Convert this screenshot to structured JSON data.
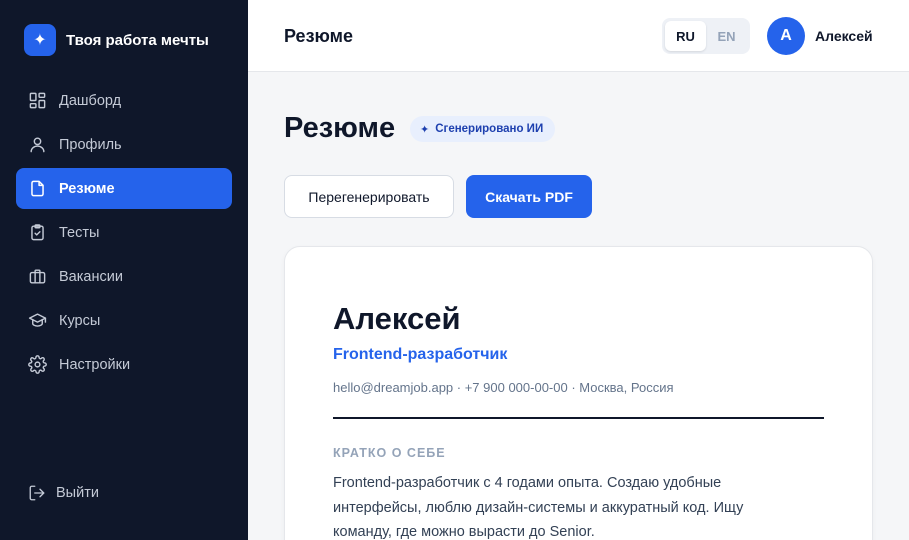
{
  "brand": {
    "title": "Твоя работа мечты",
    "logo_icon": "sparkle-icon"
  },
  "sidebar": {
    "items": [
      {
        "label": "Дашборд",
        "icon": "dashboard-icon",
        "active": false
      },
      {
        "label": "Профиль",
        "icon": "user-icon",
        "active": false
      },
      {
        "label": "Резюме",
        "icon": "document-icon",
        "active": true
      },
      {
        "label": "Тесты",
        "icon": "clipboard-check-icon",
        "active": false
      },
      {
        "label": "Вакансии",
        "icon": "briefcase-icon",
        "active": false
      },
      {
        "label": "Курсы",
        "icon": "graduation-cap-icon",
        "active": false
      },
      {
        "label": "Настройки",
        "icon": "gear-icon",
        "active": false
      }
    ],
    "logout_label": "Выйти"
  },
  "header": {
    "title": "Резюме",
    "languages": [
      "RU",
      "EN"
    ],
    "active_language": "RU",
    "user": {
      "initial": "А",
      "name": "Алексей"
    }
  },
  "main": {
    "title": "Резюме",
    "badge": "Сгенерировано ИИ",
    "regenerate_label": "Перегенерировать",
    "download_label": "Скачать PDF"
  },
  "resume": {
    "name": "Алексей",
    "role": "Frontend-разработчик",
    "contacts": "hello@dreamjob.app · +7 900 000-00-00 · Москва, Россия",
    "about_title": "КРАТКО О СЕБЕ",
    "about_text": "Frontend-разработчик с 4 годами опыта. Создаю удобные интерфейсы, люблю дизайн-системы и аккуратный код. Ищу команду, где можно вырасти до Senior."
  },
  "colors": {
    "accent": "#2563eb",
    "sidebar_bg": "#0f172a",
    "page_bg": "#f5f6f8"
  }
}
